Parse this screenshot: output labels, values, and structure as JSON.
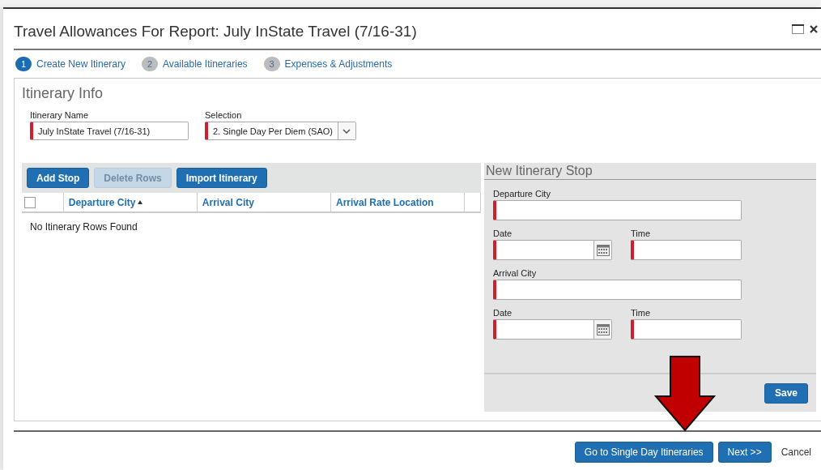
{
  "dialog": {
    "title": "Travel Allowances For Report: July InState Travel (7/16-31)"
  },
  "steps": [
    {
      "number": "1",
      "label": "Create New Itinerary",
      "selected": true
    },
    {
      "number": "2",
      "label": "Available Itineraries",
      "selected": false
    },
    {
      "number": "3",
      "label": "Expenses & Adjustments",
      "selected": false
    }
  ],
  "itinerary_info": {
    "heading": "Itinerary Info",
    "fields": [
      {
        "kind": "text",
        "label": "Itinerary Name",
        "value": "July InState Travel (7/16-31)",
        "required": true
      },
      {
        "kind": "select",
        "label": "Selection",
        "value": "2. Single Day Per Diem (SAO)",
        "required": true
      }
    ]
  },
  "toolbar": [
    {
      "label": "Add Stop",
      "disabled": false
    },
    {
      "label": "Delete Rows",
      "disabled": true
    },
    {
      "label": "Import Itinerary",
      "disabled": false
    }
  ],
  "table": {
    "select_all_checked": false,
    "columns": [
      {
        "label": "Departure City",
        "sorted_ascending": true
      },
      {
        "label": "Arrival City",
        "sorted_ascending": false
      },
      {
        "label": "Arrival Rate Location",
        "sorted_ascending": false
      }
    ],
    "empty_message": "No Itinerary Rows Found"
  },
  "stop_form": {
    "heading": "New Itinerary Stop",
    "fields": [
      {
        "kind": "wide",
        "label": "Departure City",
        "required": true
      },
      {
        "kind": "date",
        "label": "Date",
        "required": true
      },
      {
        "kind": "time",
        "label": "Time",
        "required": true
      },
      {
        "kind": "wide",
        "label": "Arrival City",
        "required": true
      },
      {
        "kind": "date",
        "label": "Date",
        "required": true
      },
      {
        "kind": "time",
        "label": "Time",
        "required": true
      }
    ],
    "save": "Save"
  },
  "footer": {
    "buttons": [
      {
        "kind": "primary",
        "label": "Go to Single Day Itineraries"
      },
      {
        "kind": "primary",
        "label": "Next >>"
      },
      {
        "kind": "link",
        "label": "Cancel"
      }
    ]
  }
}
